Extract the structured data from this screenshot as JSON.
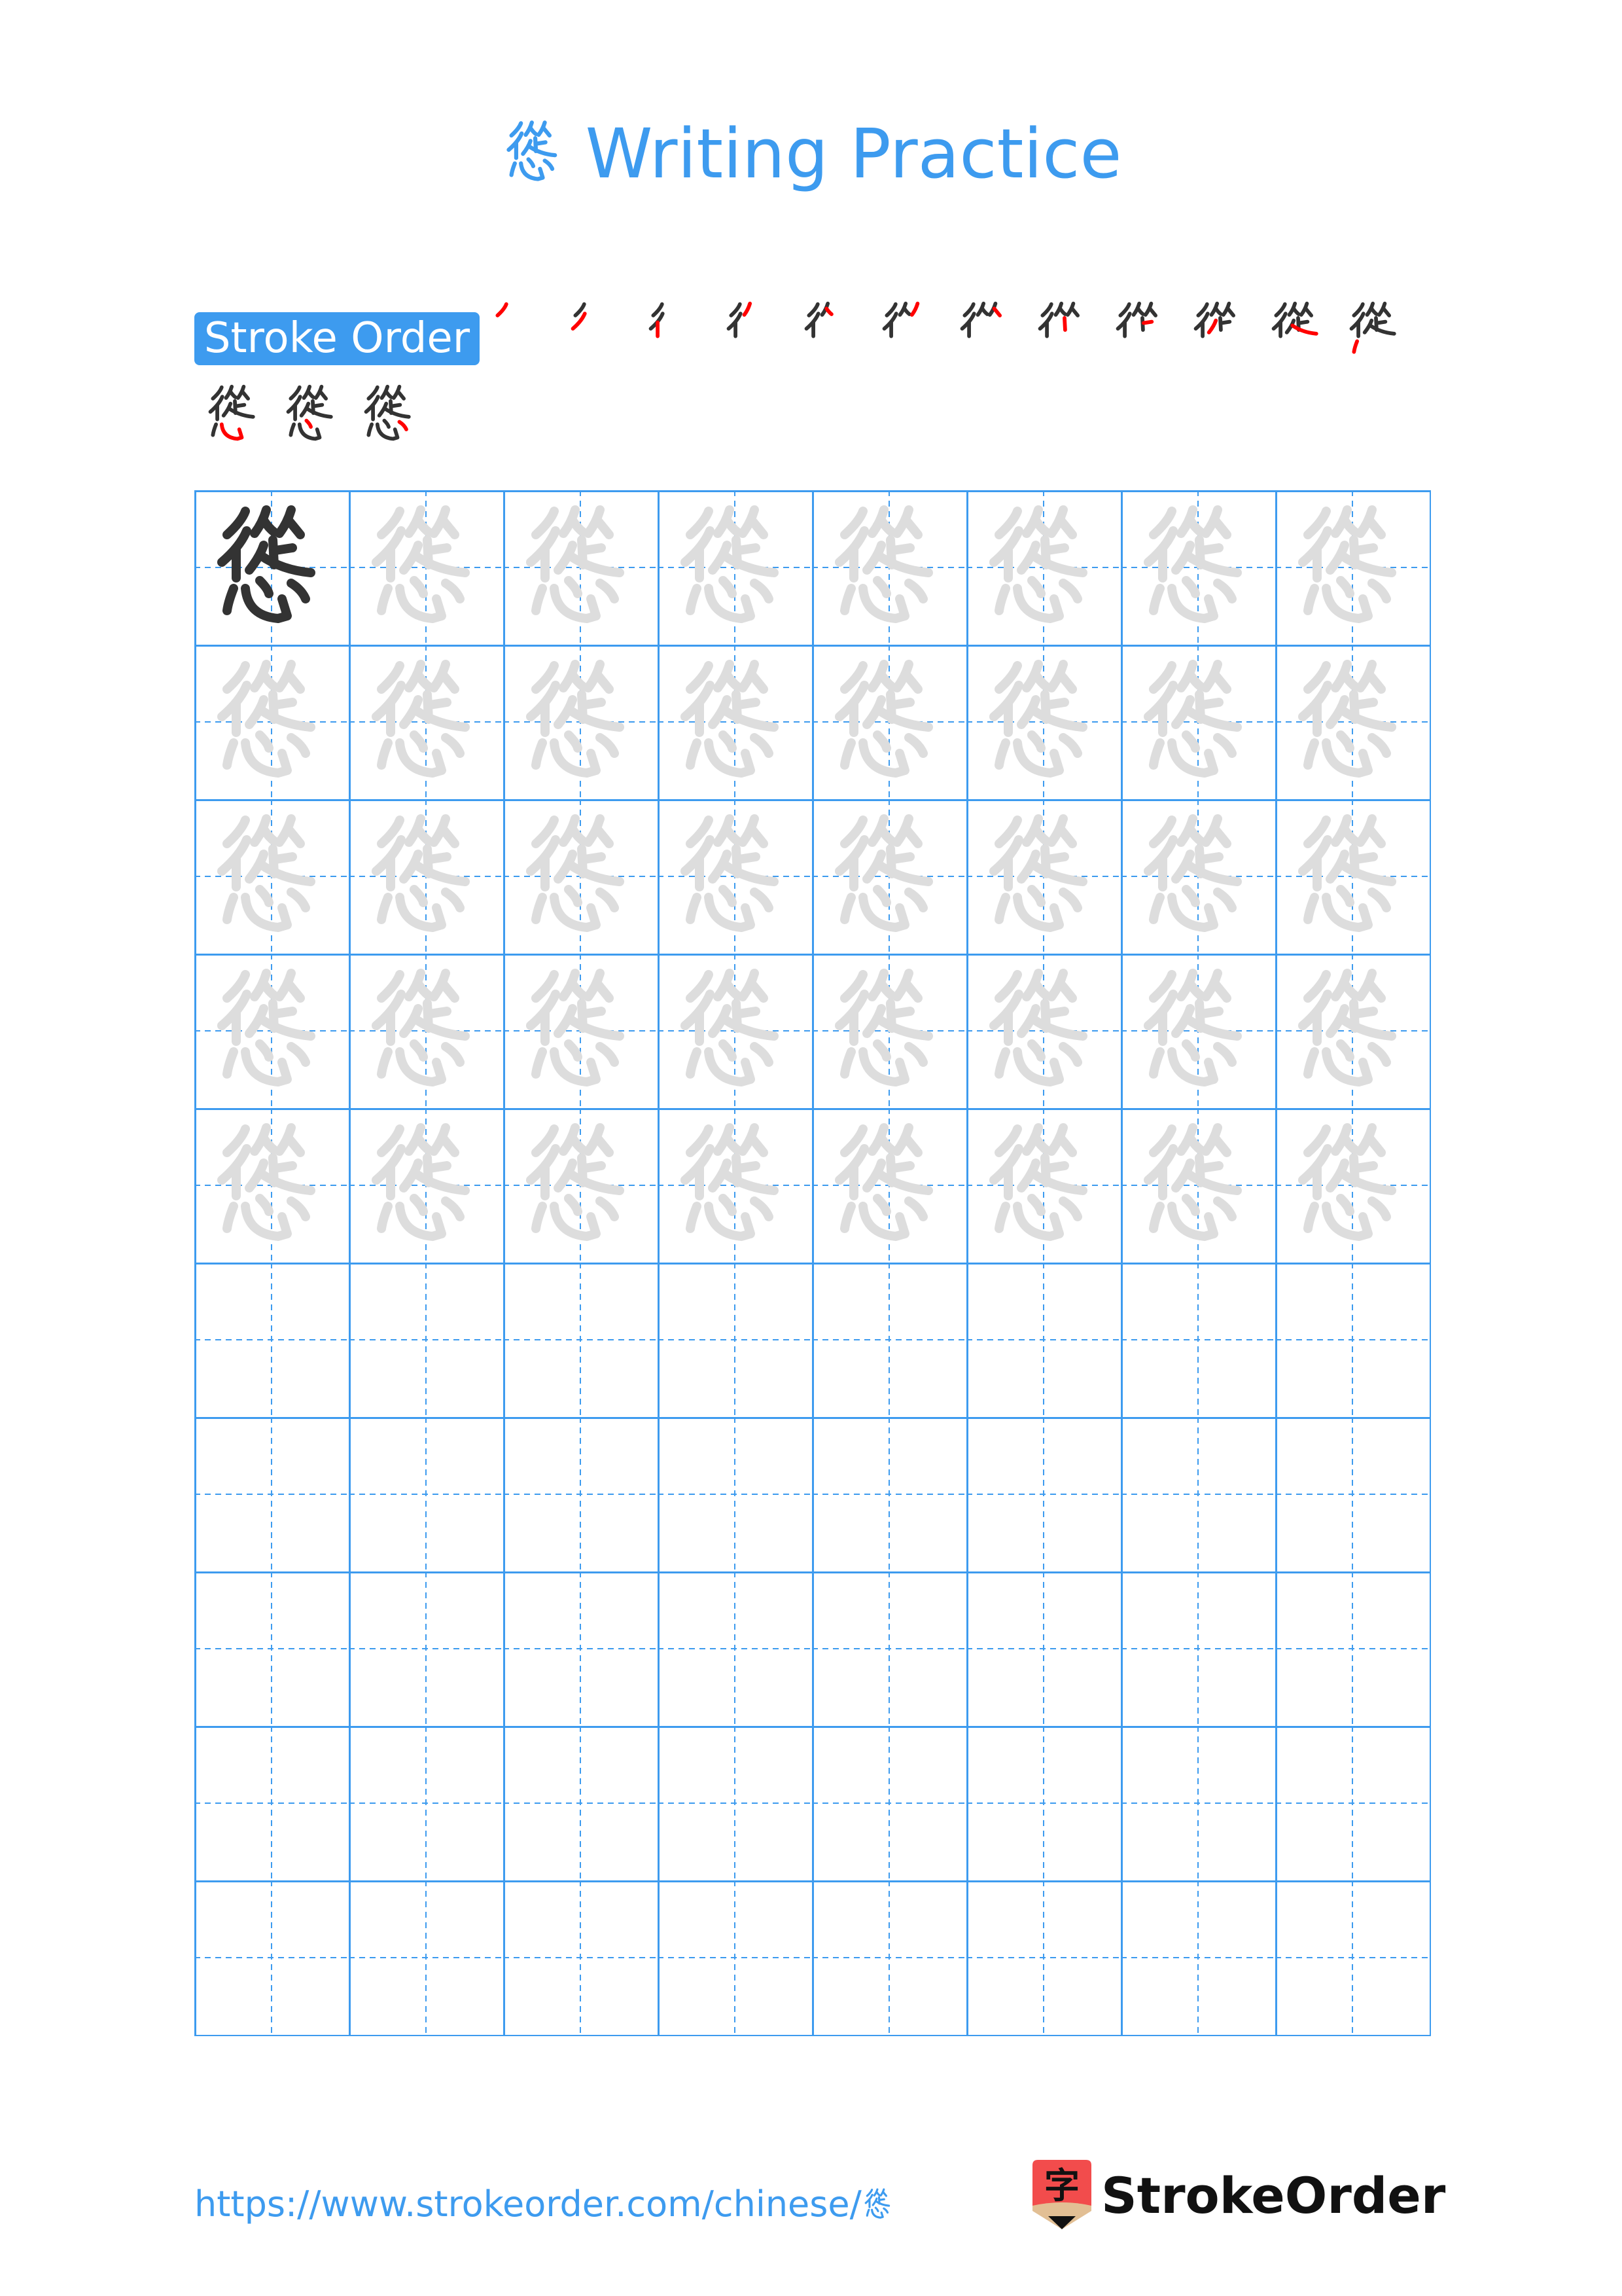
{
  "page": {
    "character": "慫",
    "title_suffix": "Writing Practice",
    "stroke_order_label": "Stroke Order",
    "stroke_count": 15,
    "footer_url": "https://www.strokeorder.com/chinese/慫",
    "brand_name": "StrokeOrder",
    "brand_icon_char": "字"
  },
  "colors": {
    "accent": "#3d9bef",
    "ink": "#333333",
    "current_stroke": "#ff0000",
    "trace": "#dddddd",
    "logo_red": "#f24c4c",
    "logo_tan": "#e2bf94"
  },
  "grid": {
    "columns": 8,
    "rows": 10,
    "model_cells": 1,
    "traced_rows": 5
  }
}
